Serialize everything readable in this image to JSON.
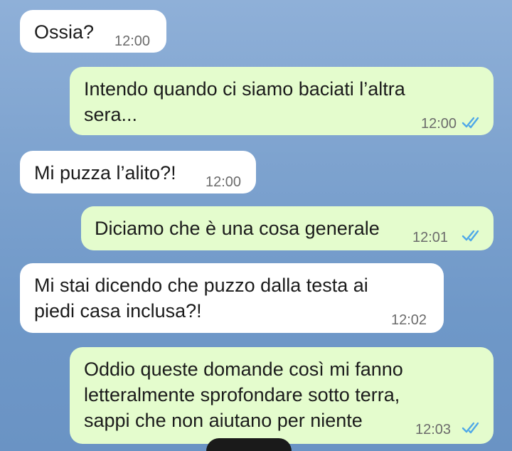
{
  "messages": [
    {
      "direction": "incoming",
      "text": "Ossia?",
      "time": "12:00"
    },
    {
      "direction": "outgoing",
      "lines": [
        "Intendo quando ci siamo baciati l’altra",
        "sera..."
      ],
      "time": "12:00",
      "status": "read"
    },
    {
      "direction": "incoming",
      "text": "Mi puzza l’alito?!",
      "time": "12:00"
    },
    {
      "direction": "outgoing",
      "text": "Diciamo che è una cosa generale",
      "time": "12:01",
      "status": "read"
    },
    {
      "direction": "incoming",
      "lines": [
        "Mi stai dicendo che puzzo dalla testa ai",
        "piedi casa inclusa?!"
      ],
      "time": "12:02"
    },
    {
      "direction": "outgoing",
      "lines": [
        "Oddio queste domande così mi fanno",
        "letteralmente sprofondare sotto terra,",
        "sappi che non aiutano per niente"
      ],
      "time": "12:03",
      "status": "read"
    }
  ],
  "colors": {
    "incoming": "#ffffff",
    "outgoing": "#e4fccd",
    "read_ticks": "#4fa8e8"
  },
  "icons": {
    "read_status": "double-check-icon"
  }
}
